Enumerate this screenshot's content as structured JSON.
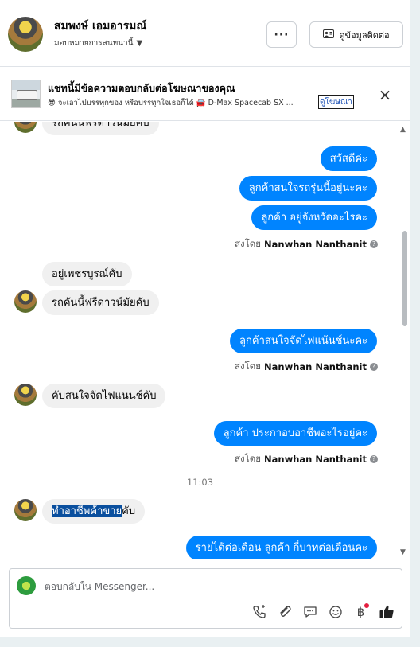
{
  "header": {
    "name": "สมพงษ์ เอมอารมณ์",
    "assign_label": "มอบหมายการสนทนานี้",
    "more_label": "···",
    "contact_label": "ดูข้อมูลติดต่อ"
  },
  "ad": {
    "title": "แชทนี้มีข้อความตอบกลับต่อโฆษณาของคุณ",
    "description": "😎 จะเอาไปบรรทุกของ หรือบรรทุกใจเธอก็ได้ 🚘 D-Max Spacecab SX ...",
    "link": "ดูโฆษณา"
  },
  "messages": [
    {
      "dir": "in",
      "text": "รถคันนี้ฟรีดาวน์มัยคับ"
    },
    {
      "dir": "out",
      "text": "สวัสดีค่ะ"
    },
    {
      "dir": "out",
      "text": "ลูกค้าสนใจรถรุ่นนี้อยู่นะคะ"
    },
    {
      "dir": "out",
      "text": "ลูกค้า อยู่จังหวัดอะไรคะ"
    },
    {
      "dir": "in",
      "text": "อยู่เพชรบูรณ์คับ"
    },
    {
      "dir": "in",
      "text": "รถคันนี้ฟรีดาวน์มัยคับ"
    },
    {
      "dir": "out",
      "text": "ลูกค้าสนใจจัดไฟแน้นช์นะคะ"
    },
    {
      "dir": "in",
      "text": "คับสนใจจัดไฟแนนช์คับ"
    },
    {
      "dir": "out",
      "text": "ลูกค้า ประกาอบอาชีพอะไรอยู่คะ"
    },
    {
      "dir": "in",
      "text_selected": "ทำอาชีพค้าขาย",
      "text_rest": "คับ"
    },
    {
      "dir": "out",
      "text": "รายได้ต่อเดือน ลูกค้า กี่บาทต่อเดือนคะ"
    }
  ],
  "sent_by": {
    "prefix": "ส่งโดย",
    "name": "Nanwhan Nanthanit"
  },
  "time_separator": "11:03",
  "composer": {
    "placeholder": "ตอบกลับใน Messenger..."
  }
}
